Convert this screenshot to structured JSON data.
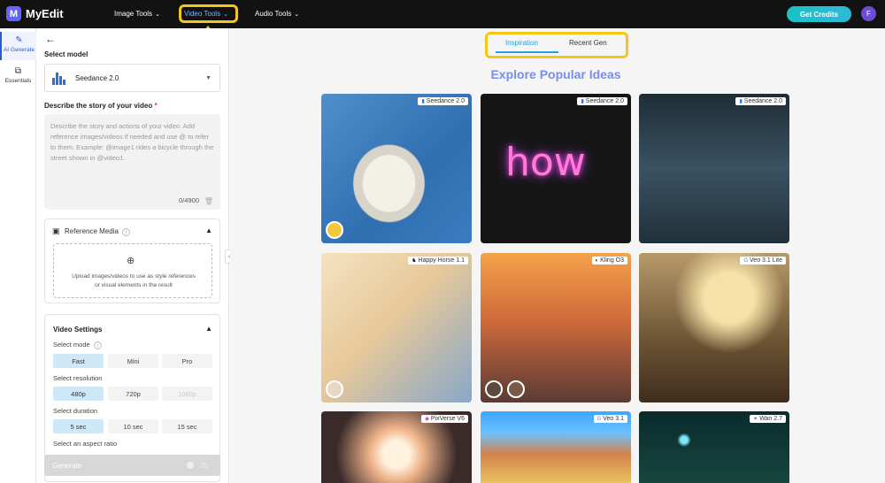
{
  "header": {
    "brand": "MyEdit",
    "logo_letter": "M",
    "nav": [
      {
        "label": "Image Tools"
      },
      {
        "label": "Video Tools"
      },
      {
        "label": "Audio Tools"
      }
    ],
    "credits_button": "Get Credits",
    "avatar_letter": "F"
  },
  "rail": {
    "items": [
      {
        "label": "AI Generate",
        "icon": "wand-icon",
        "active": true
      },
      {
        "label": "Essentials",
        "icon": "layers-icon",
        "active": false
      }
    ]
  },
  "form": {
    "select_model_label": "Select model",
    "model_value": "Seedance 2.0",
    "story_label": "Describe the story of your video",
    "story_required_mark": "*",
    "story_placeholder": "Describe the story and actions of your video. Add reference images/videos if needed and use @ to refer to them. Example: @image1 rides a bicycle through the street shown in @video1.",
    "char_count": "0/4900",
    "reference_media_title": "Reference Media",
    "upload_text": "Upload images/videos to use as style references or visual elements in the result",
    "video_settings_title": "Video Settings",
    "select_mode_label": "Select mode",
    "modes": [
      "Fast",
      "Mini",
      "Pro"
    ],
    "selected_mode": "Fast",
    "select_resolution_label": "Select resolution",
    "resolutions": [
      "480p",
      "720p",
      "1080p"
    ],
    "selected_resolution": "480p",
    "disabled_resolution": "1080p",
    "select_duration_label": "Select duration",
    "durations": [
      "5 sec",
      "10 sec",
      "15 sec"
    ],
    "selected_duration": "5 sec",
    "aspect_ratio_label": "Select an aspect ratio",
    "generate_button": "Generate",
    "generate_cost": "35"
  },
  "main": {
    "tabs": [
      {
        "label": "Inspiration",
        "active": true
      },
      {
        "label": "Recent Gen",
        "active": false
      }
    ],
    "title": "Explore Popular Ideas",
    "cards": [
      {
        "model": "Seedance 2.0"
      },
      {
        "model": "Seedance 2.0",
        "overlay_text": "how"
      },
      {
        "model": "Seedance 2.0"
      },
      {
        "model": "Happy Horse 1.1"
      },
      {
        "model": "Kling O3"
      },
      {
        "model": "Veo 3.1 Lite"
      },
      {
        "model": "PixVerse V6"
      },
      {
        "model": "Veo 3.1"
      },
      {
        "model": "Wan 2.7"
      }
    ]
  },
  "colors": {
    "accent_blue": "#2a9fd6",
    "highlight_yellow": "#f5c518",
    "credits_teal": "#19c2c6"
  }
}
